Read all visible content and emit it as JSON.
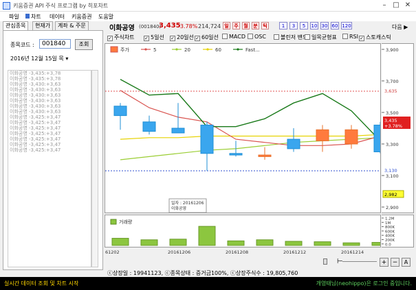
{
  "window": {
    "title": "키움증권 API 주식 프로그램 by 히포차트",
    "minimize": "–",
    "maximize": "□",
    "close": "✕"
  },
  "menu": [
    "파일",
    "차트",
    "데이터",
    "키움증권",
    "도움말"
  ],
  "left_tabs": [
    "관심종목",
    "현재가",
    "계좌 & 주문"
  ],
  "left": {
    "code_label": "종목코드 :",
    "code_value": "001840",
    "search_button": "조회",
    "date_value": "2016년 12월 15일 목",
    "log_lines": [
      "이화공영 -3,435:+3,78",
      "이화공영 -3,435:+3,78",
      "이화공영 -3,430:+3,63",
      "이화공영 -3,430:+3,63",
      "이화공영 -3,430:+3,63",
      "이화공영 -3,430:+3,63",
      "이화공영 -3,430:+3,63",
      "이화공영 -3,430:+3,63",
      "이화공영 -3,425:+3,47",
      "이화공영 -3,425:+3,47",
      "이화공영 -3,425:+3,47",
      "이화공영 -3,425:+3,47",
      "이화공영 -3,425:+3,47",
      "이화공영 -3,425:+3,47",
      "이화공영 -3,425:+3,47"
    ]
  },
  "header": {
    "stock_name": "이화공영",
    "stock_code": "(001840)",
    "price": "3,435",
    "change": "-3.78%",
    "volume": "214,724",
    "periods_kr": [
      "일",
      "주",
      "월",
      "분",
      "틱"
    ],
    "periods_num": [
      "1",
      "3",
      "5",
      "10",
      "30",
      "60",
      "120"
    ],
    "next": "다음 ▶"
  },
  "indicators": [
    {
      "label": "주식차트",
      "checked": true
    },
    {
      "label": "5일선",
      "checked": true
    },
    {
      "label": "20일선",
      "checked": true
    },
    {
      "label": "60일선",
      "checked": true
    },
    {
      "label": "MACD",
      "checked": false
    },
    {
      "label": "OSC",
      "checked": false
    },
    {
      "label": "볼린저 밴드",
      "checked": false
    },
    {
      "label": "일목균형표",
      "checked": false
    },
    {
      "label": "RSI",
      "checked": false
    },
    {
      "label": "스토캐스틱",
      "checked": true
    }
  ],
  "legend": [
    {
      "label": "주가",
      "color": "#ff7a3d"
    },
    {
      "label": "5",
      "color": "#d9534f"
    },
    {
      "label": "20",
      "color": "#9acd32"
    },
    {
      "label": "60",
      "color": "#e6d200"
    },
    {
      "label": "Fast...",
      "color": "#1a7a1a"
    }
  ],
  "tooltip": {
    "date": "일자 : 20161206",
    "name": "이화공영"
  },
  "price_axis": [
    "3,900",
    "3,700",
    "3,500",
    "3,300",
    "3,100",
    "2,900"
  ],
  "price_tags": {
    "top": "3,635",
    "bottom": "3,130",
    "current": "3,435",
    "current_change": "+3.78%",
    "low_mark": "2,982"
  },
  "volume_label": "거래량",
  "volume_axis": [
    "1.2M",
    "1M",
    "800K",
    "600K",
    "400K",
    "200K",
    "0.0"
  ],
  "x_labels": [
    "61202",
    "20161206",
    "20161208",
    "20161212",
    "20161214"
  ],
  "zoom_buttons": [
    "+",
    "−",
    "A"
  ],
  "status_info": "ⓒ상장일 : 19941123, ⓒ종목상태 : 증거금100%, ⓒ상장주식수 : 19,805,760",
  "statusbar": {
    "left": "실시간 데이터 조회 및 차트 시작",
    "right": "개영태님(neohippo)은 로그인 중입니다."
  },
  "chart_data": {
    "type": "candlestick",
    "x": [
      "20161202",
      "20161205",
      "20161206",
      "20161207",
      "20161208",
      "20161209",
      "20161212",
      "20161213",
      "20161214",
      "20161215"
    ],
    "open": [
      3540,
      3440,
      3400,
      3420,
      3240,
      3220,
      3330,
      3320,
      3300,
      3420
    ],
    "close": [
      3480,
      3380,
      3370,
      3240,
      3230,
      3230,
      3270,
      3390,
      3390,
      3250
    ],
    "high": [
      3560,
      3480,
      3560,
      3440,
      3320,
      3280,
      3400,
      3420,
      3420,
      3440
    ],
    "low": [
      3390,
      3360,
      3370,
      3130,
      3220,
      3200,
      3250,
      3250,
      3270,
      3240
    ],
    "ma5": [
      3640,
      3530,
      3470,
      3440,
      3330,
      3310,
      3290,
      3290,
      3300,
      3350
    ],
    "ma20": [
      3200,
      3220,
      3240,
      3260,
      3270,
      3290,
      3310,
      3320,
      3330,
      3340
    ],
    "ma60": [
      3330,
      3340,
      3340,
      3350,
      3350,
      3350,
      3350,
      3350,
      3350,
      3360
    ],
    "fast": [
      3710,
      3610,
      3620,
      3410,
      3410,
      3460,
      3560,
      3620,
      3510,
      3320
    ],
    "volume": [
      330000,
      260000,
      290000,
      880000,
      210000,
      260000,
      190000,
      170000,
      120000,
      140000
    ],
    "ylim": [
      2900,
      3900
    ],
    "volume_ylim": [
      0,
      1200000
    ],
    "hlines": [
      3635,
      3130
    ]
  }
}
